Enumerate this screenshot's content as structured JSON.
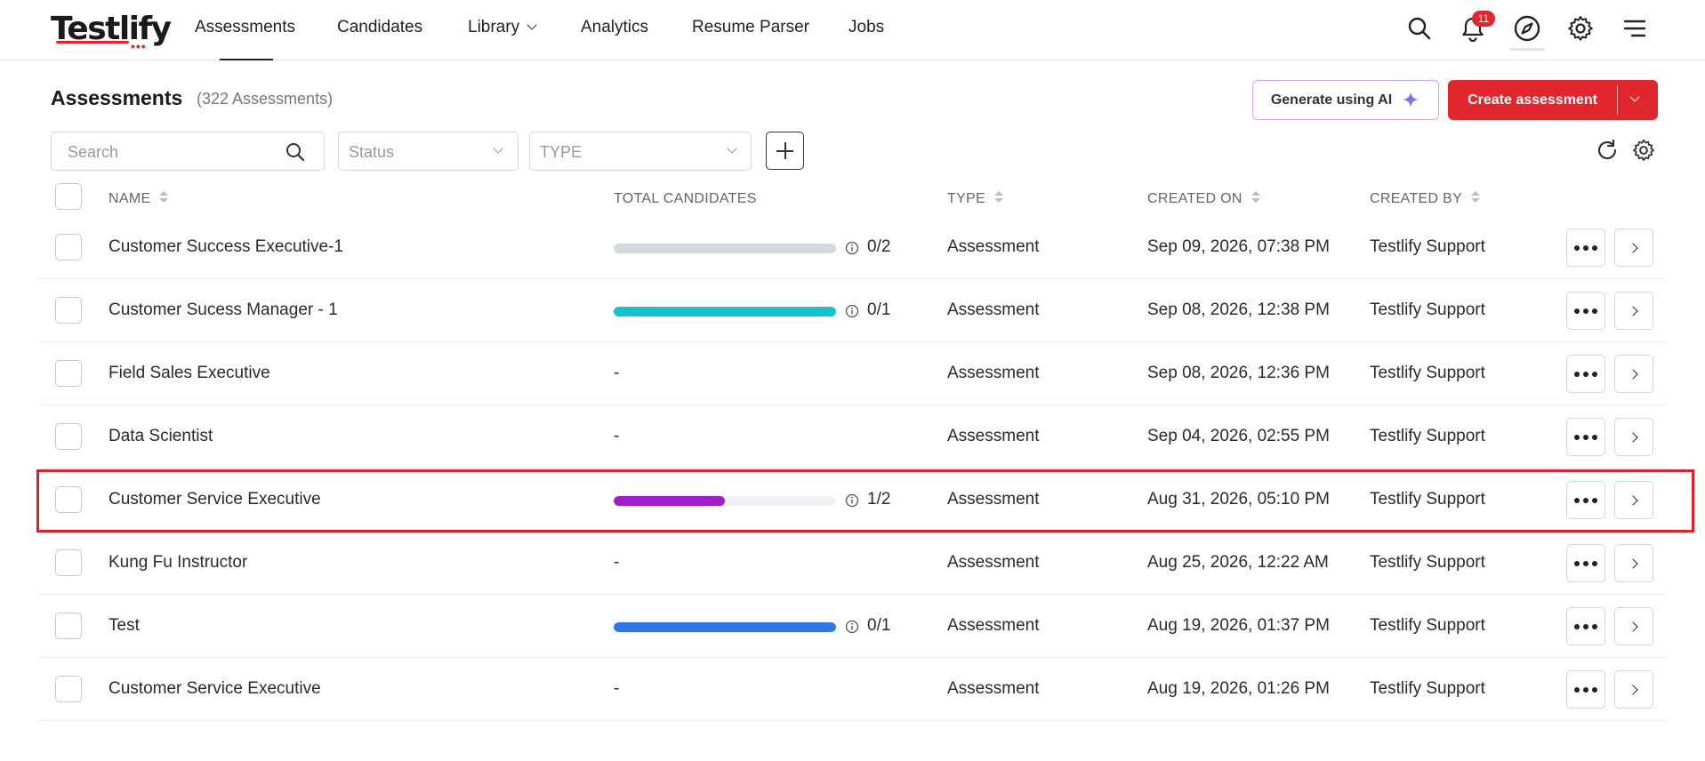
{
  "brand": {
    "name": "Testlify"
  },
  "nav": {
    "items": [
      {
        "label": "Assessments",
        "active": true
      },
      {
        "label": "Candidates"
      },
      {
        "label": "Library",
        "has_dropdown": true
      },
      {
        "label": "Analytics"
      },
      {
        "label": "Resume Parser"
      },
      {
        "label": "Jobs"
      }
    ],
    "icons": [
      "search-icon",
      "bell-icon",
      "compass-icon",
      "gear-icon",
      "menu-icon"
    ],
    "notification_count": "11"
  },
  "page": {
    "title": "Assessments",
    "count_label": "(322 Assessments)",
    "generate_label": "Generate using AI",
    "create_label": "Create assessment"
  },
  "filters": {
    "search_placeholder": "Search",
    "status_placeholder": "Status",
    "type_placeholder": "TYPE"
  },
  "table": {
    "headers": {
      "name": "NAME",
      "total_candidates": "TOTAL CANDIDATES",
      "type": "TYPE",
      "created_on": "CREATED ON",
      "created_by": "CREATED BY"
    },
    "rows": [
      {
        "name": "Customer Success Executive-1",
        "candidates": "0/2",
        "progress": 0,
        "progress_color": "#d4d9de",
        "type": "Assessment",
        "created_on": "Sep 09, 2026, 07:38 PM",
        "created_by": "Testlify Support"
      },
      {
        "name": "Customer Sucess Manager - 1",
        "candidates": "0/1",
        "progress": 100,
        "progress_color": "#15c3cc",
        "type": "Assessment",
        "created_on": "Sep 08, 2026, 12:38 PM",
        "created_by": "Testlify Support"
      },
      {
        "name": "Field Sales Executive",
        "candidates": "-",
        "type": "Assessment",
        "created_on": "Sep 08, 2026, 12:36 PM",
        "created_by": "Testlify Support"
      },
      {
        "name": "Data Scientist",
        "candidates": "-",
        "type": "Assessment",
        "created_on": "Sep 04, 2026, 02:55 PM",
        "created_by": "Testlify Support"
      },
      {
        "name": "Customer Service Executive",
        "candidates": "1/2",
        "progress": 50,
        "progress_color": "#a21cc9",
        "type": "Assessment",
        "created_on": "Aug 31, 2026, 05:10 PM",
        "created_by": "Testlify Support",
        "highlighted": true
      },
      {
        "name": "Kung Fu Instructor",
        "candidates": "-",
        "type": "Assessment",
        "created_on": "Aug 25, 2026, 12:22 AM",
        "created_by": "Testlify Support"
      },
      {
        "name": "Test",
        "candidates": "0/1",
        "progress": 100,
        "progress_color": "#2e78e6",
        "type": "Assessment",
        "created_on": "Aug 19, 2026, 01:37 PM",
        "created_by": "Testlify Support"
      },
      {
        "name": "Customer Service Executive",
        "candidates": "-",
        "type": "Assessment",
        "created_on": "Aug 19, 2026, 01:26 PM",
        "created_by": "Testlify Support"
      }
    ]
  },
  "colors": {
    "accent": "#e2262e",
    "ai_border": "#cfa8ef",
    "ai_sparkle": "#8a6cf0",
    "highlight": "#d92128"
  }
}
